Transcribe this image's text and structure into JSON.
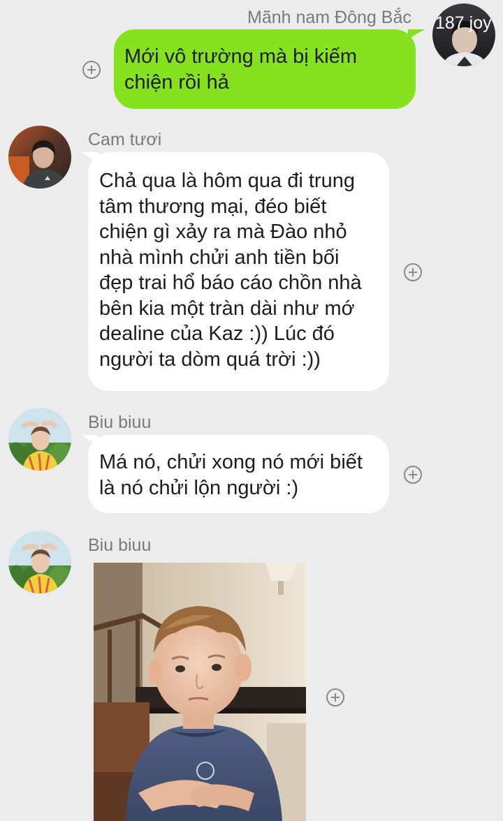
{
  "messages": [
    {
      "sender": "Mãnh nam Đông Bắc",
      "avatar_label": "187 joy",
      "text": "Mới vô trường mà bị kiếm\nchiện rồi hả",
      "side": "right",
      "bubble_color": "#86e21e"
    },
    {
      "sender": "Cam tươi",
      "text": "Chả qua là hôm qua đi trung\ntâm thương mại, đéo biết\nchiện gì xảy ra mà Đào nhỏ\nnhà mình chửi anh tiền bối\nđẹp trai hổ báo cáo chồn nhà\nbên kia một tràn dài như mớ\ndealine của Kaz :)) Lúc đó\nngười ta dòm quá trời :))",
      "side": "left",
      "bubble_color": "#ffffff"
    },
    {
      "sender": "Biu biuu",
      "text": "Má nó, chửi xong nó mới biết\nlà nó chửi lộn người :)",
      "side": "left",
      "bubble_color": "#ffffff"
    },
    {
      "sender": "Biu biuu",
      "image_description": "photo-message",
      "side": "left"
    }
  ],
  "colors": {
    "background": "#ececec",
    "outgoing_bubble": "#86e21e",
    "incoming_bubble": "#ffffff",
    "sender_name": "#7a7a7a",
    "icon_gray": "#8a8a8a"
  },
  "icons": {
    "reaction_button": "plus-circle-icon"
  }
}
